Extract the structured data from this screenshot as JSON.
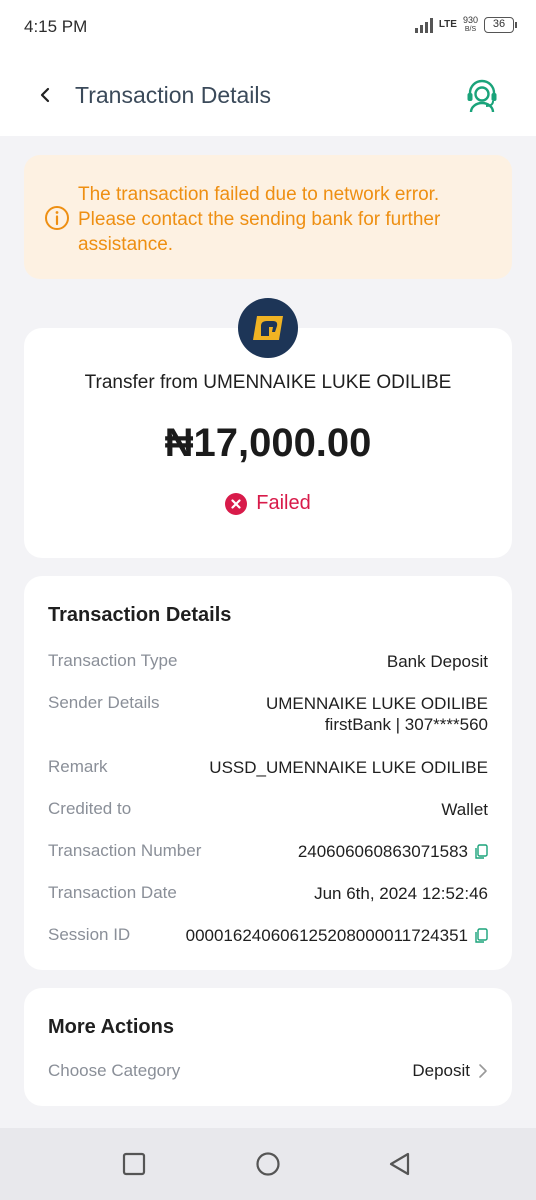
{
  "status_bar": {
    "time": "4:15 PM",
    "network": "LTE",
    "speed_value": "930",
    "speed_unit": "B/S",
    "battery": "36"
  },
  "header": {
    "title": "Transaction Details",
    "back_icon": "chevron-left-icon",
    "support_icon": "headset-support-icon",
    "accent_color": "#1aa37a"
  },
  "alert": {
    "icon": "info-icon",
    "message": "The transaction failed due to network error. Please contact the sending bank for further assistance.",
    "text_color": "#ee8f12",
    "bg_color": "#fdf1e2"
  },
  "summary": {
    "bank_logo_icon": "bank-elephant-logo",
    "transfer_text": "Transfer from UMENNAIKE LUKE ODILIBE",
    "amount": "₦17,000.00",
    "status": "Failed",
    "status_color": "#d81b4a"
  },
  "details": {
    "title": "Transaction Details",
    "rows": [
      {
        "label": "Transaction Type",
        "value": "Bank Deposit"
      },
      {
        "label": "Sender Details",
        "value": "UMENNAIKE LUKE ODILIBE",
        "value2": "firstBank | 307****560"
      },
      {
        "label": "Remark",
        "value": "USSD_UMENNAIKE LUKE ODILIBE"
      },
      {
        "label": "Credited to",
        "value": "Wallet"
      },
      {
        "label": "Transaction Number",
        "value": "240606060863071583"
      },
      {
        "label": "Transaction Date",
        "value": "Jun 6th, 2024 12:52:46"
      },
      {
        "label": "Session ID",
        "value": "000016240606125208000011724351"
      }
    ]
  },
  "more_actions": {
    "title": "More Actions",
    "choose_label": "Choose Category",
    "choose_value": "Deposit"
  },
  "nav_bar": {
    "recents_icon": "square-recents-icon",
    "home_icon": "circle-home-icon",
    "back_icon": "triangle-back-icon"
  }
}
